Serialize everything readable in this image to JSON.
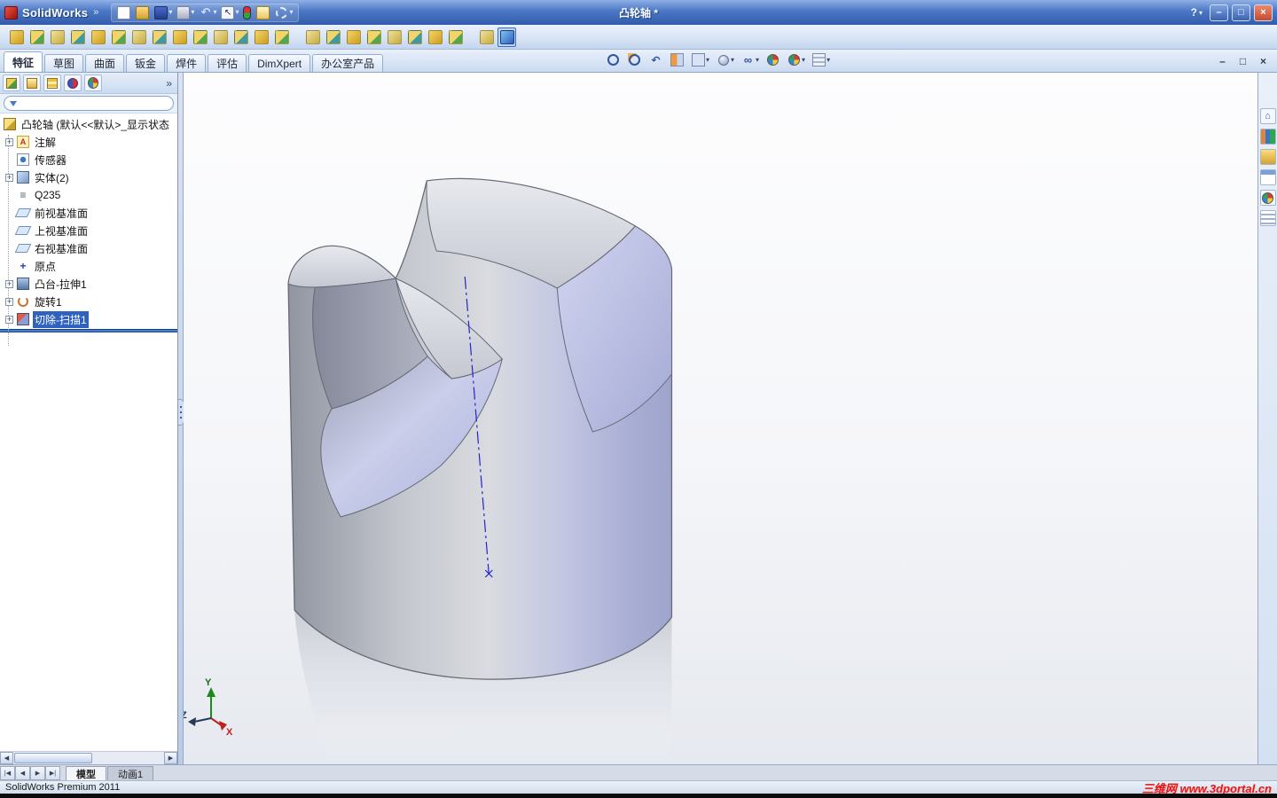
{
  "window": {
    "app_name": "SolidWorks",
    "logo_chevron": "»",
    "doc_title": "凸轮轴 *",
    "help_label": "?",
    "caret": "▾",
    "minimize": "–",
    "restore": "□",
    "close": "×"
  },
  "title_toolbar": {
    "icons": [
      {
        "icon": "new-icon"
      },
      {
        "icon": "open-icon"
      },
      {
        "icon": "save-icon",
        "caret": "▾"
      },
      {
        "icon": "print-icon",
        "caret": "▾"
      },
      {
        "icon": "undo-icon",
        "caret": "▾"
      },
      {
        "icon": "select-icon",
        "caret": "▾"
      },
      {
        "icon": "rebuild-icon"
      },
      {
        "icon": "file-properties-icon"
      },
      {
        "icon": "options-icon",
        "caret": "▾"
      }
    ]
  },
  "toolbar2": {
    "icons": [
      {
        "icon": "base-flange-icon"
      },
      {
        "icon": "sketch-relations-icon"
      },
      {
        "icon": "lofted-bend-icon"
      },
      {
        "icon": "edge-flange-icon"
      },
      {
        "icon": "miter-flange-icon"
      },
      {
        "icon": "hem-icon"
      },
      {
        "icon": "jog-icon"
      },
      {
        "icon": "sketched-bend-icon"
      },
      {
        "icon": "cross-break-icon"
      },
      {
        "icon": "closed-corner-icon"
      },
      {
        "icon": "corner-relief-icon"
      },
      {
        "icon": "forming-tool-icon"
      },
      {
        "icon": "pattern-icon"
      },
      {
        "icon": "pattern-table-icon"
      },
      {
        "icon": "extruded-cut-icon"
      },
      {
        "icon": "simple-hole-icon"
      },
      {
        "icon": "vent-icon"
      },
      {
        "icon": "unfold-icon"
      },
      {
        "icon": "fold-icon"
      },
      {
        "icon": "flatten-icon"
      },
      {
        "icon": "rip-icon"
      },
      {
        "icon": "insert-bends-icon"
      },
      {
        "icon": "helix-icon"
      },
      {
        "icon": "swept-cut-icon",
        "state": "active"
      }
    ]
  },
  "command_tabs": [
    {
      "label": "特征",
      "state": "active"
    },
    {
      "label": "草图"
    },
    {
      "label": "曲面"
    },
    {
      "label": "钣金"
    },
    {
      "label": "焊件"
    },
    {
      "label": "评估"
    },
    {
      "label": "DimXpert"
    },
    {
      "label": "办公室产品"
    }
  ],
  "headsup": {
    "icons": [
      {
        "icon": "zoom-fit-icon"
      },
      {
        "icon": "zoom-area-icon"
      },
      {
        "icon": "previous-view-icon"
      },
      {
        "icon": "section-view-icon"
      },
      {
        "icon": "view-orientation-icon",
        "caret": "▾"
      },
      {
        "icon": "display-style-icon",
        "caret": "▾"
      },
      {
        "icon": "hide-show-items-icon",
        "caret": "▾"
      },
      {
        "icon": "edit-appearance-icon"
      },
      {
        "icon": "apply-scene-icon",
        "caret": "▾"
      },
      {
        "icon": "view-settings-icon",
        "caret": "▾"
      }
    ]
  },
  "doc_controls": {
    "minimize": "–",
    "restore": "□",
    "close": "×"
  },
  "feature_manager": {
    "header_tabs": [
      {
        "icon": "featuremanager-tab-icon"
      },
      {
        "icon": "propertymanager-tab-icon"
      },
      {
        "icon": "configurationmanager-tab-icon"
      },
      {
        "icon": "dimxpertmanager-tab-icon"
      },
      {
        "icon": "displaymanager-tab-icon"
      }
    ],
    "header_overflow": "»",
    "filter": {
      "value": ""
    },
    "root_label": "凸轮轴 (默认<<默认>_显示状态",
    "items": [
      {
        "label": "注解",
        "icon": "annotations-icon",
        "expand": "+"
      },
      {
        "label": "传感器",
        "icon": "sensors-icon",
        "expand": ""
      },
      {
        "label": "实体(2)",
        "icon": "solid-bodies-icon",
        "expand": "+"
      },
      {
        "label": "Q235",
        "icon": "material-icon",
        "expand": ""
      },
      {
        "label": "前视基准面",
        "icon": "plane-icon",
        "expand": ""
      },
      {
        "label": "上视基准面",
        "icon": "plane-icon",
        "expand": ""
      },
      {
        "label": "右视基准面",
        "icon": "plane-icon",
        "expand": ""
      },
      {
        "label": "原点",
        "icon": "origin-icon",
        "expand": ""
      },
      {
        "label": "凸台-拉伸1",
        "icon": "boss-extrude-icon",
        "expand": "+"
      },
      {
        "label": "旋转1",
        "icon": "revolve-icon",
        "expand": "+"
      },
      {
        "label": "切除-扫描1",
        "icon": "cut-sweep-icon",
        "expand": "+",
        "state": "selected"
      }
    ],
    "hscroll": {
      "left": "◀",
      "right": "▶"
    }
  },
  "viewport": {
    "triad": {
      "x": "X",
      "y": "Y",
      "z": "Z"
    }
  },
  "taskpane": {
    "icons": [
      "home-icon",
      "design-library-icon",
      "file-explorer-icon",
      "view-palette-icon",
      "appearances-icon",
      "custom-properties-icon"
    ]
  },
  "bottom_bar": {
    "nav": [
      {
        "icon": "first-sheet-icon",
        "glyph": "|◀"
      },
      {
        "icon": "prev-sheet-icon",
        "glyph": "◀"
      },
      {
        "icon": "next-sheet-icon",
        "glyph": "▶"
      },
      {
        "icon": "last-sheet-icon",
        "glyph": "▶|"
      }
    ],
    "tabs": [
      {
        "label": "模型",
        "state": "active"
      },
      {
        "label": "动画1"
      }
    ]
  },
  "statusbar": {
    "left": "SolidWorks Premium 2011",
    "watermark": "三维网 www.3dportal.cn"
  }
}
